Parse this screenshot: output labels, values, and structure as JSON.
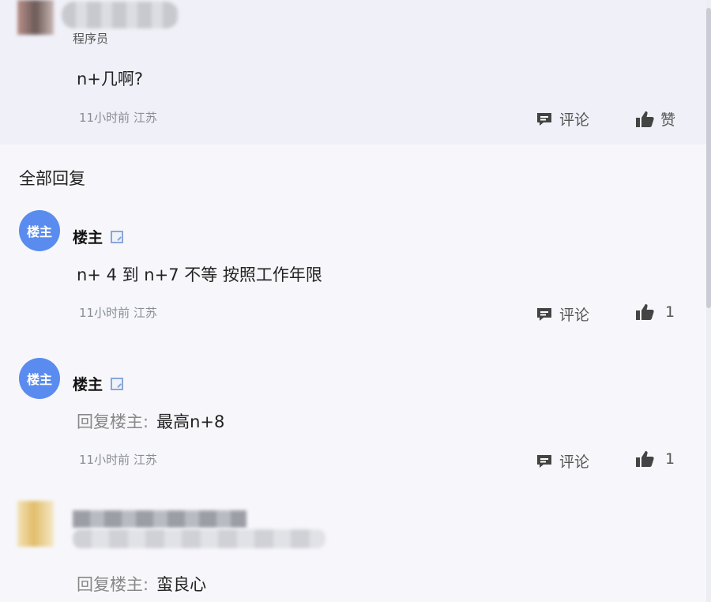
{
  "op": {
    "role": "程序员",
    "body": "n+几啊?",
    "meta": "11小时前 江苏",
    "comment_label": "评论",
    "like_label": "赞"
  },
  "section_title": "全部回复",
  "replies": [
    {
      "avatar_text": "楼主",
      "author": "楼主",
      "text": "n+ 4 到 n+7 不等 按照工作年限",
      "meta": "11小时前 江苏",
      "comment_label": "评论",
      "like_count": "1"
    },
    {
      "avatar_text": "楼主",
      "author": "楼主",
      "prefix": "回复楼主:",
      "text": "最高n+8",
      "meta": "11小时前 江苏",
      "comment_label": "评论",
      "like_count": "1"
    },
    {
      "prefix": "回复楼主:",
      "text": "蛮良心"
    }
  ],
  "icons": {
    "comment": "comment-icon",
    "like": "thumbs-up-icon",
    "verified": "verified-badge-icon"
  },
  "colors": {
    "avatar_blue": "#5a8cf0",
    "meta_gray": "#8a8d96",
    "op_background": "#f0f0f8"
  }
}
